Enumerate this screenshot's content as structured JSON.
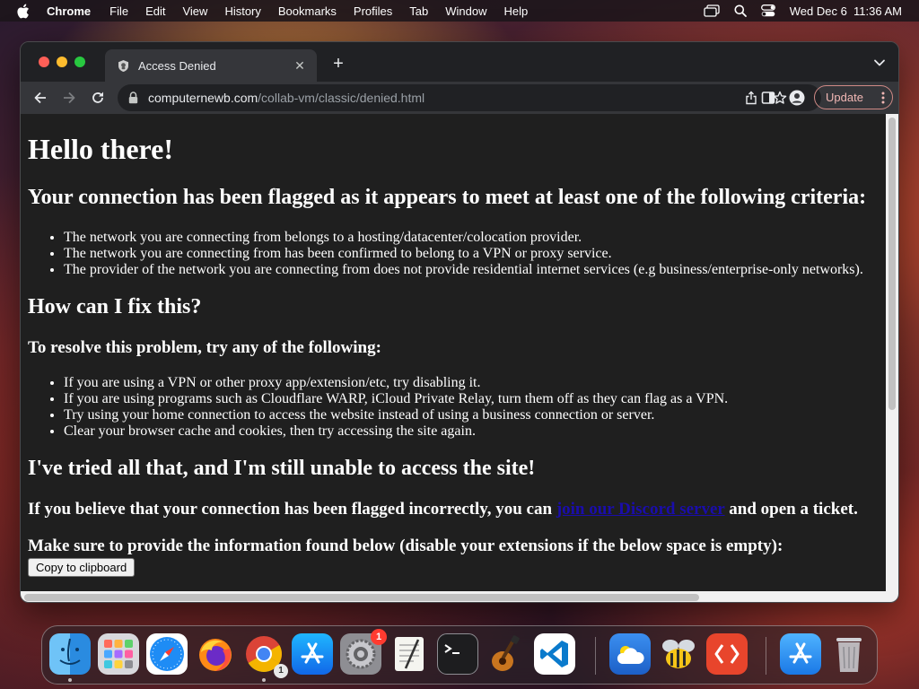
{
  "menubar": {
    "app_name": "Chrome",
    "menus": [
      "File",
      "Edit",
      "View",
      "History",
      "Bookmarks",
      "Profiles",
      "Tab",
      "Window",
      "Help"
    ],
    "clock": "Wed Dec 6  11:36 AM"
  },
  "browser": {
    "tab_title": "Access Denied",
    "url_host": "computernewb.com",
    "url_path": "/collab-vm/classic/denied.html",
    "update_label": "Update"
  },
  "page": {
    "h1": "Hello there!",
    "flag_heading": "Your connection has been flagged as it appears to meet at least one of the following criteria:",
    "criteria": [
      "The network you are connecting from belongs to a hosting/datacenter/colocation provider.",
      "The network you are connecting from has been confirmed to belong to a VPN or proxy service.",
      "The provider of the network you are connecting from does not provide residential internet services (e.g business/enterprise-only networks)."
    ],
    "fix_heading": "How can I fix this?",
    "resolve_heading": "To resolve this problem, try any of the following:",
    "fixes": [
      "If you are using a VPN or other proxy app/extension/etc, try disabling it.",
      "If you are using programs such as Cloudflare WARP, iCloud Private Relay, turn them off as they can flag as a VPN.",
      "Try using your home connection to access the website instead of using a business connection or server.",
      "Clear your browser cache and cookies, then try accessing the site again."
    ],
    "tried_heading": "I've tried all that, and I'm still unable to access the site!",
    "incorrect_prefix": "If you believe that your connection has been flagged incorrectly, you can",
    "discord_link": "join our Discord server",
    "incorrect_suffix": "and open a ticket.",
    "provide_info": "Make sure to provide the information found below (disable your extensions if the below space is empty):",
    "copy_button": "Copy to clipboard"
  },
  "dock": {
    "settings_badge": "1",
    "chrome_badge": "1",
    "apps": [
      "finder-icon",
      "launchpad-icon",
      "safari-icon",
      "firefox-icon",
      "chrome-icon",
      "app-store-icon",
      "system-settings-icon",
      "textedit-icon",
      "terminal-icon",
      "garageband-icon",
      "vscode-icon",
      "weather-icon",
      "bee-app-icon",
      "remote-desktop-icon",
      "app-store-downloads-icon",
      "trash-icon"
    ]
  }
}
